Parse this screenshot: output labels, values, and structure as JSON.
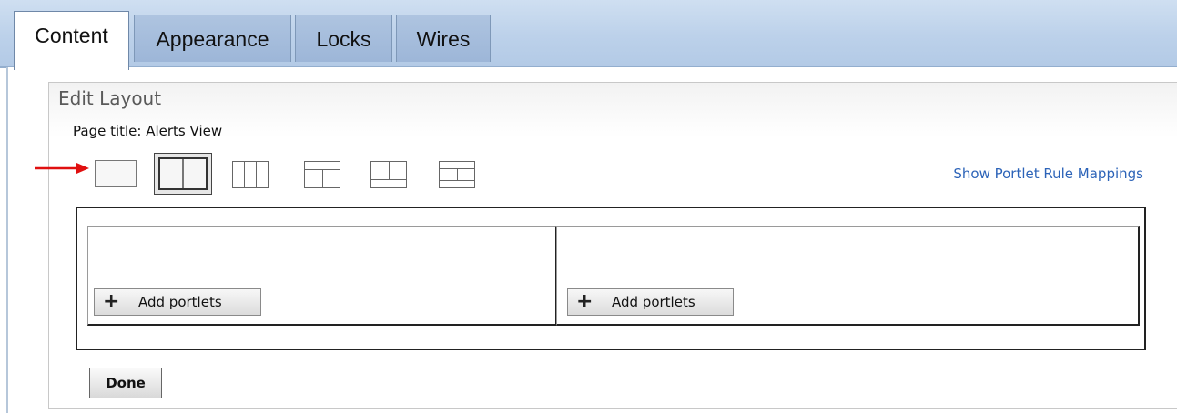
{
  "tabs": [
    {
      "label": "Content",
      "active": true
    },
    {
      "label": "Appearance",
      "active": false
    },
    {
      "label": "Locks",
      "active": false
    },
    {
      "label": "Wires",
      "active": false
    }
  ],
  "panel": {
    "title": "Edit Layout",
    "page_title": "Page title: Alerts View"
  },
  "layout_options": [
    {
      "icon": "layout-1-column-icon",
      "selected": false
    },
    {
      "icon": "layout-2-column-icon",
      "selected": true
    },
    {
      "icon": "layout-3-column-icon",
      "selected": false
    },
    {
      "icon": "layout-top-row-2-columns-icon",
      "selected": false
    },
    {
      "icon": "layout-2-columns-bottom-row-icon",
      "selected": false
    },
    {
      "icon": "layout-top-row-2-columns-bottom-row-icon",
      "selected": false
    }
  ],
  "indicator": {
    "icon": "red-arrow-icon",
    "color": "#e01010"
  },
  "show_rule_mappings_label": "Show Portlet Rule  Mappings",
  "columns": [
    {
      "add_label": "Add portlets"
    },
    {
      "add_label": "Add portlets"
    }
  ],
  "done_label": "Done",
  "colors": {
    "tab_bar": "#bcd1ea",
    "link": "#2c63b8"
  }
}
